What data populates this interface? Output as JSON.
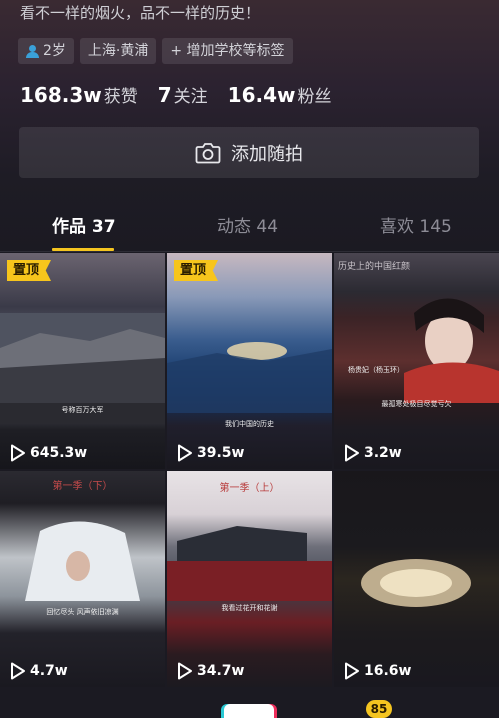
{
  "profile": {
    "bio": "看不一样的烟火，品不一样的历史！",
    "tags": [
      "2岁",
      "上海·黄浦",
      "+ 增加学校等标签"
    ],
    "stats": [
      {
        "value": "168.3w",
        "label": "获赞"
      },
      {
        "value": "7",
        "label": "关注"
      },
      {
        "value": "16.4w",
        "label": "粉丝"
      }
    ],
    "add_photo_label": "添加随拍"
  },
  "tabs": [
    {
      "label": "作品 37",
      "active": true
    },
    {
      "label": "动态 44",
      "active": false
    },
    {
      "label": "喜欢 145",
      "active": false
    }
  ],
  "videos": [
    {
      "pinned": true,
      "pin_label": "置顶",
      "plays": "645.3w",
      "caption": "",
      "subtitle": "号称百万大军",
      "top_text": ""
    },
    {
      "pinned": true,
      "pin_label": "置顶",
      "plays": "39.5w",
      "caption": "",
      "subtitle": "我们中国的历史",
      "top_text": ""
    },
    {
      "pinned": false,
      "pin_label": "",
      "plays": "3.2w",
      "caption": "杨贵妃（杨玉环）",
      "subtitle": "最孤寒处极目尽觉亏欠",
      "top_text": "历史上的中国红颜"
    },
    {
      "pinned": false,
      "pin_label": "",
      "plays": "4.7w",
      "caption": "",
      "subtitle": "回忆尽头 风声依旧凉渊",
      "top_text": "第一季（下）"
    },
    {
      "pinned": false,
      "pin_label": "",
      "plays": "34.7w",
      "caption": "",
      "subtitle": "我看过花开和花谢",
      "top_text": "第一季（上）"
    },
    {
      "pinned": false,
      "pin_label": "",
      "plays": "16.6w",
      "caption": "",
      "subtitle": "",
      "top_text": ""
    }
  ],
  "bottom_nav": {
    "badge": "85"
  },
  "colors": {
    "accent": "#f5c520",
    "background": "#1b1a22"
  }
}
